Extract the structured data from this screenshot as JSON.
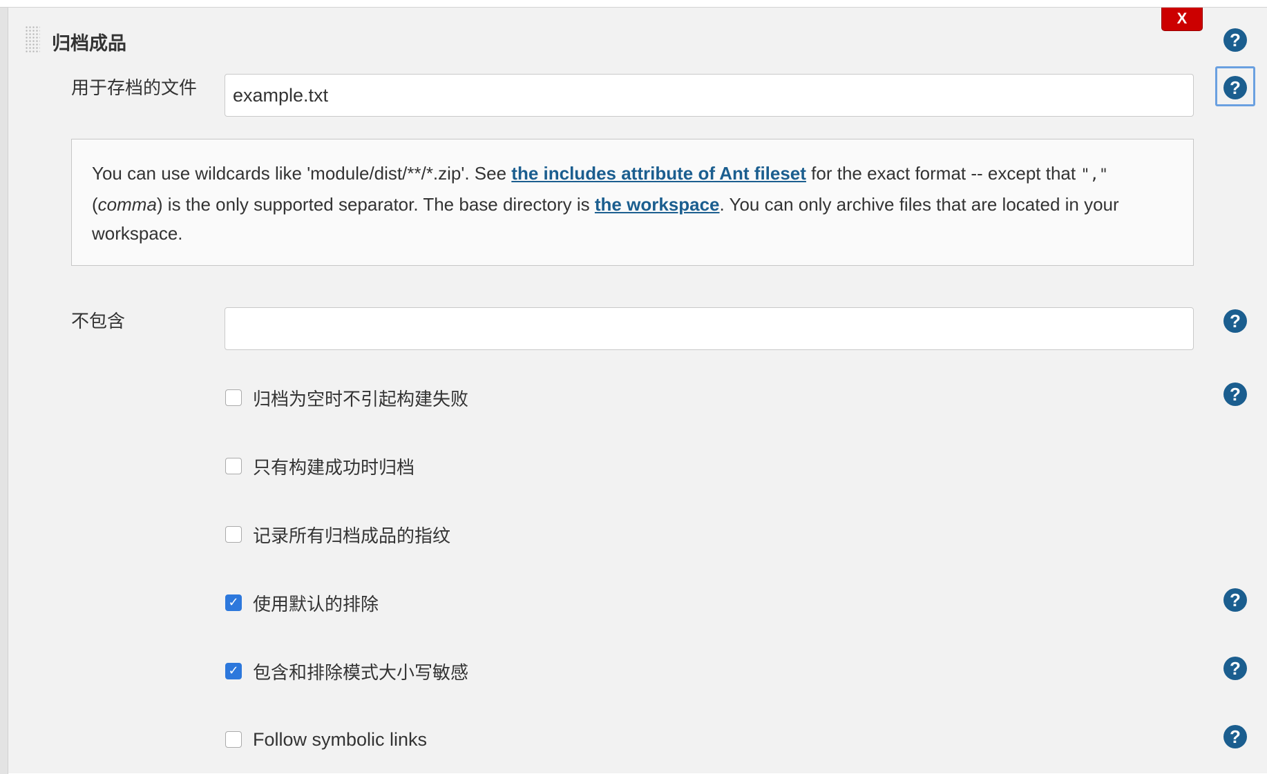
{
  "section": {
    "title": "归档成品",
    "delete_label": "X"
  },
  "help_label": "?",
  "files_field": {
    "label": "用于存档的文件",
    "value": "example.txt"
  },
  "description": {
    "p1": "You can use wildcards like 'module/dist/**/*.zip'. See ",
    "link1": "the includes attribute of Ant fileset",
    "p2": " for the exact format -- except that ",
    "code": "\",\"",
    "p3": " (",
    "em": "comma",
    "p4": ") is the only supported separator. The base directory is ",
    "link2": "the workspace",
    "p5": ". You can only archive files that are located in your workspace."
  },
  "excludes_field": {
    "label": "不包含",
    "value": ""
  },
  "options": [
    {
      "label": "归档为空时不引起构建失败",
      "checked": false
    },
    {
      "label": "只有构建成功时归档",
      "checked": false
    },
    {
      "label": "记录所有归档成品的指纹",
      "checked": false
    },
    {
      "label": "使用默认的排除",
      "checked": true
    },
    {
      "label": "包含和排除模式大小写敏感",
      "checked": true
    },
    {
      "label": "Follow symbolic links",
      "checked": false
    }
  ],
  "colors": {
    "help_icon": "#1b5e8f",
    "link": "#1b5e8f",
    "delete_button": "#cc0000",
    "checkbox_checked": "#2d78dc"
  }
}
